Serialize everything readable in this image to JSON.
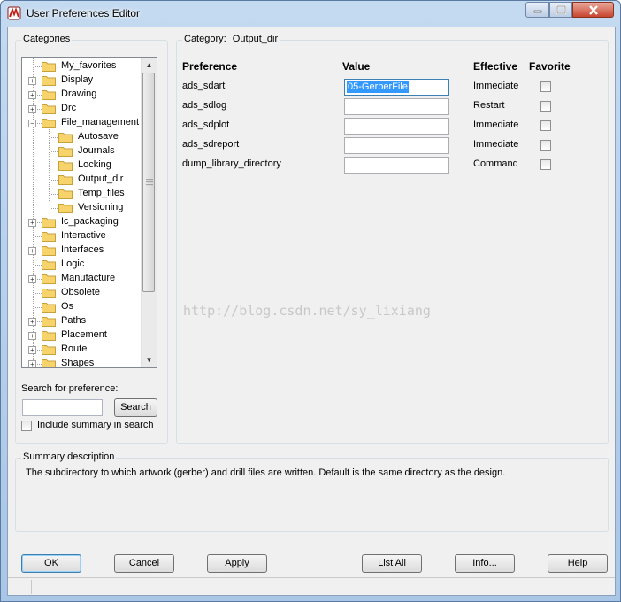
{
  "window": {
    "title": "User Preferences Editor"
  },
  "categories": {
    "label": "Categories",
    "items": [
      {
        "label": "My_favorites",
        "expander": ""
      },
      {
        "label": "Display",
        "expander": "+"
      },
      {
        "label": "Drawing",
        "expander": "+"
      },
      {
        "label": "Drc",
        "expander": "+"
      },
      {
        "label": "File_management",
        "expander": "−"
      },
      {
        "label": "Autosave",
        "expander": ""
      },
      {
        "label": "Journals",
        "expander": ""
      },
      {
        "label": "Locking",
        "expander": ""
      },
      {
        "label": "Output_dir",
        "expander": ""
      },
      {
        "label": "Temp_files",
        "expander": ""
      },
      {
        "label": "Versioning",
        "expander": ""
      },
      {
        "label": "Ic_packaging",
        "expander": "+"
      },
      {
        "label": "Interactive",
        "expander": ""
      },
      {
        "label": "Interfaces",
        "expander": "+"
      },
      {
        "label": "Logic",
        "expander": ""
      },
      {
        "label": "Manufacture",
        "expander": "+"
      },
      {
        "label": "Obsolete",
        "expander": ""
      },
      {
        "label": "Os",
        "expander": ""
      },
      {
        "label": "Paths",
        "expander": "+"
      },
      {
        "label": "Placement",
        "expander": "+"
      },
      {
        "label": "Route",
        "expander": "+"
      },
      {
        "label": "Shapes",
        "expander": "+"
      }
    ]
  },
  "search": {
    "label": "Search for preference:",
    "value": "",
    "button": "Search",
    "include_summary_label": "Include summary in search",
    "include_summary_checked": false
  },
  "category": {
    "label": "Category:",
    "name": "Output_dir"
  },
  "table": {
    "headers": {
      "preference": "Preference",
      "value": "Value",
      "effective": "Effective",
      "favorite": "Favorite"
    },
    "rows": [
      {
        "preference": "ads_sdart",
        "value": "05-GerberFile",
        "effective": "Immediate",
        "favorite": false
      },
      {
        "preference": "ads_sdlog",
        "value": "",
        "effective": "Restart",
        "favorite": false
      },
      {
        "preference": "ads_sdplot",
        "value": "",
        "effective": "Immediate",
        "favorite": false
      },
      {
        "preference": "ads_sdreport",
        "value": "",
        "effective": "Immediate",
        "favorite": false
      },
      {
        "preference": "dump_library_directory",
        "value": "",
        "effective": "Command",
        "favorite": false
      }
    ]
  },
  "watermark": "http://blog.csdn.net/sy_lixiang",
  "summary": {
    "label": "Summary description",
    "text": "The subdirectory to which artwork (gerber) and drill files are written. Default is the same directory as the design."
  },
  "buttons": {
    "ok": "OK",
    "cancel": "Cancel",
    "apply": "Apply",
    "list_all": "List All",
    "info": "Info...",
    "help": "Help"
  },
  "colors": {
    "selection": "#3399ff",
    "watermark": "#c8c8c8",
    "folder": "#f6d46b"
  }
}
